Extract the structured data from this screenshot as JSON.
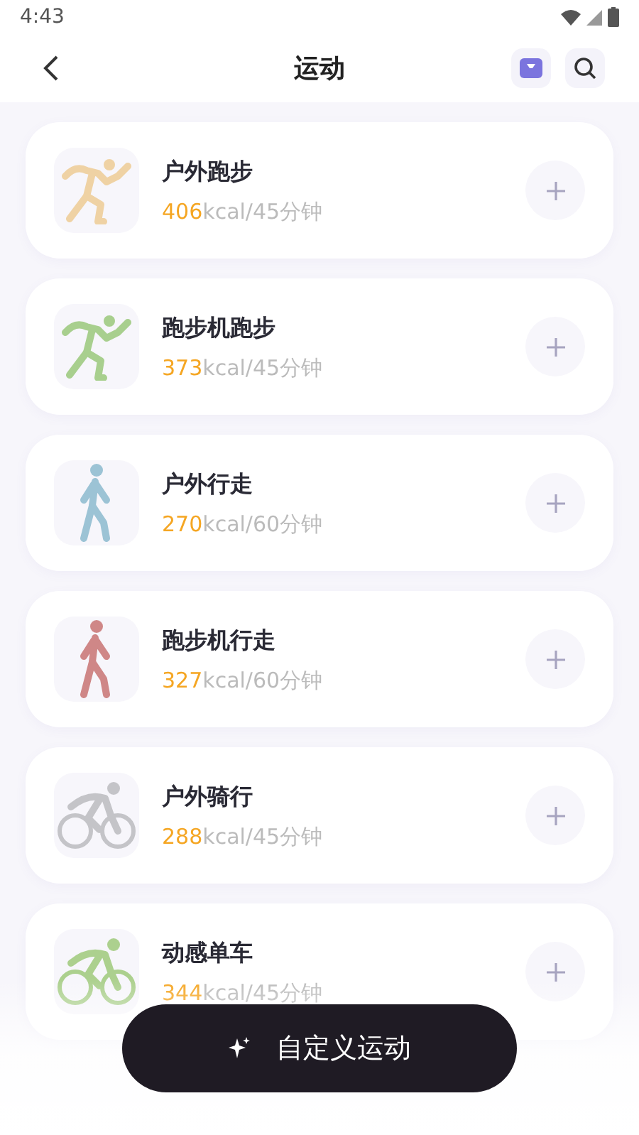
{
  "status_bar": {
    "time": "4:43"
  },
  "header": {
    "title": "运动"
  },
  "activities": [
    {
      "name": "户外跑步",
      "kcal": "406",
      "unit": "kcal/45分钟",
      "kind": "runner",
      "color": "#efd2a4"
    },
    {
      "name": "跑步机跑步",
      "kcal": "373",
      "unit": "kcal/45分钟",
      "kind": "runner",
      "color": "#a8cf8e"
    },
    {
      "name": "户外行走",
      "kcal": "270",
      "unit": "kcal/60分钟",
      "kind": "walker",
      "color": "#9cc3d5"
    },
    {
      "name": "跑步机行走",
      "kcal": "327",
      "unit": "kcal/60分钟",
      "kind": "walker",
      "color": "#cf8787"
    },
    {
      "name": "户外骑行",
      "kcal": "288",
      "unit": "kcal/45分钟",
      "kind": "cyclist",
      "color": "#c4c4c8"
    },
    {
      "name": "动感单车",
      "kcal": "344",
      "unit": "kcal/45分钟",
      "kind": "cyclist",
      "color": "#acd08e"
    }
  ],
  "custom_button": {
    "label": "自定义运动"
  }
}
